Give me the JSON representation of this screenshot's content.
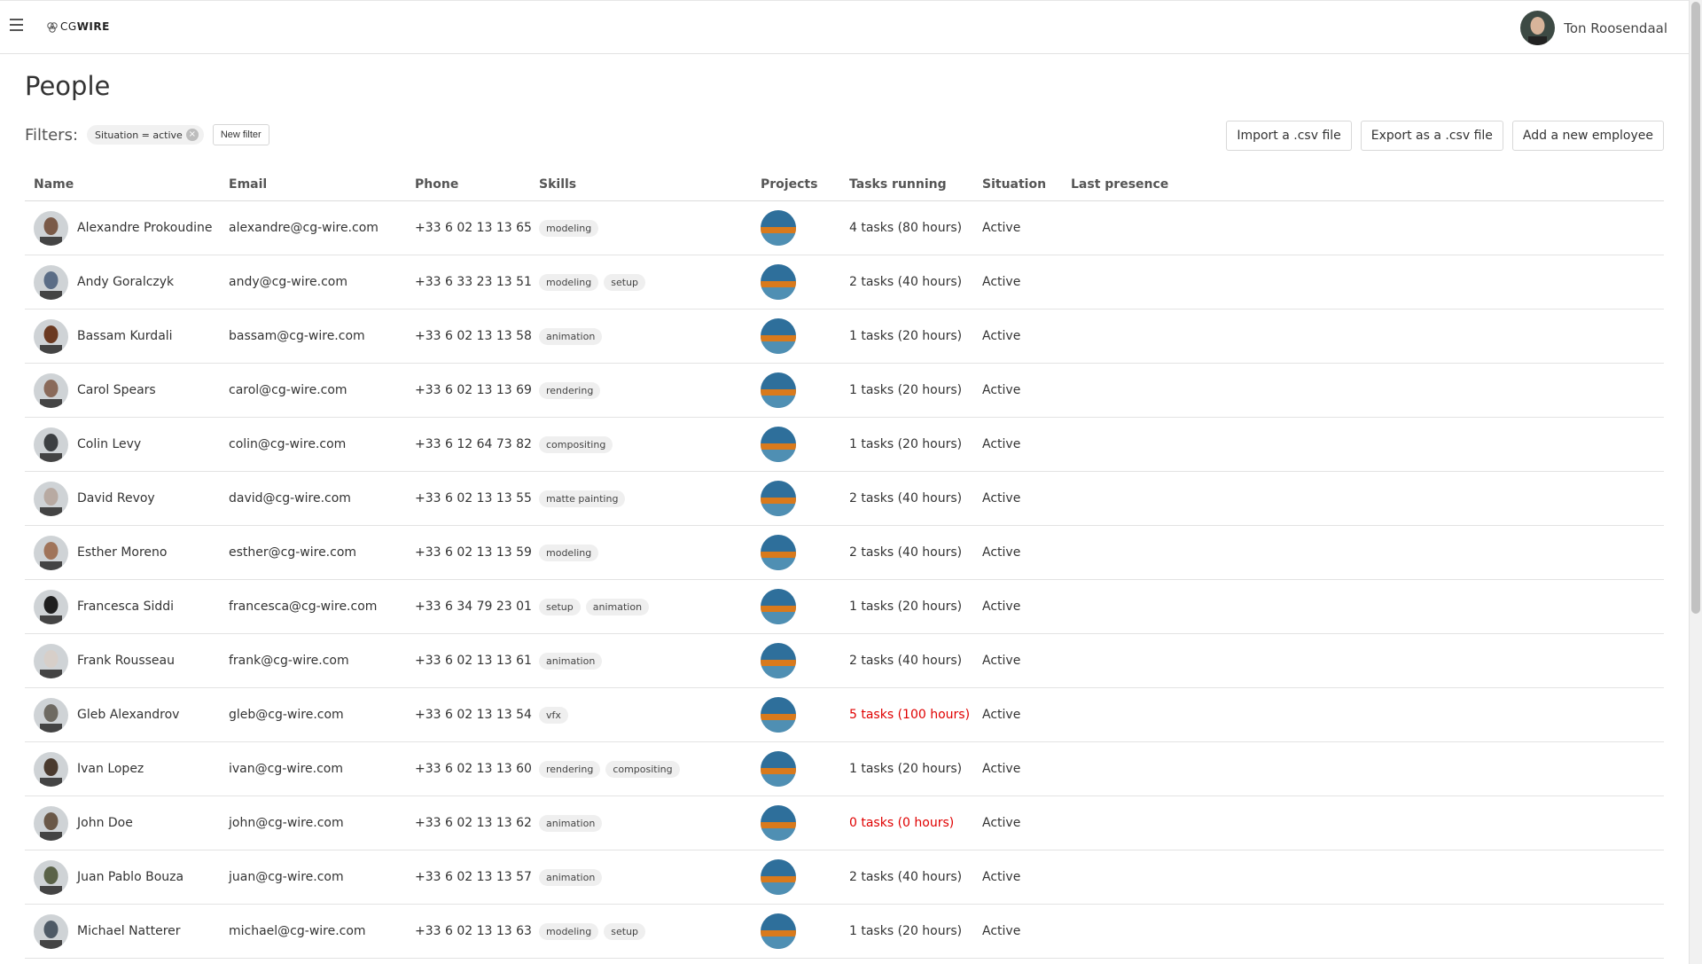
{
  "header": {
    "logo_prefix": "CG",
    "logo_suffix": "WIRE",
    "user_name": "Ton Roosendaal"
  },
  "page": {
    "title": "People",
    "filters_label": "Filters:",
    "active_filter": "Situation = active",
    "new_filter_label": "New filter",
    "import_label": "Import a .csv file",
    "export_label": "Export as a .csv file",
    "add_label": "Add a new employee"
  },
  "table": {
    "columns": {
      "name": "Name",
      "email": "Email",
      "phone": "Phone",
      "skills": "Skills",
      "projects": "Projects",
      "tasks": "Tasks running",
      "situation": "Situation",
      "last": "Last presence"
    },
    "rows": [
      {
        "name": "Alexandre Prokoudine",
        "email": "alexandre@cg-wire.com",
        "phone": "+33 6 02 13 13 65",
        "skills": [
          "modeling"
        ],
        "tasks": "4 tasks (80 hours)",
        "tasks_warn": false,
        "situation": "Active",
        "avatar_color": "#7a5a48"
      },
      {
        "name": "Andy Goralczyk",
        "email": "andy@cg-wire.com",
        "phone": "+33 6 33 23 13 51",
        "skills": [
          "modeling",
          "setup"
        ],
        "tasks": "2 tasks (40 hours)",
        "tasks_warn": false,
        "situation": "Active",
        "avatar_color": "#5b6d86"
      },
      {
        "name": "Bassam Kurdali",
        "email": "bassam@cg-wire.com",
        "phone": "+33 6 02 13 13 58",
        "skills": [
          "animation"
        ],
        "tasks": "1 tasks (20 hours)",
        "tasks_warn": false,
        "situation": "Active",
        "avatar_color": "#6b3a22"
      },
      {
        "name": "Carol Spears",
        "email": "carol@cg-wire.com",
        "phone": "+33 6 02 13 13 69",
        "skills": [
          "rendering"
        ],
        "tasks": "1 tasks (20 hours)",
        "tasks_warn": false,
        "situation": "Active",
        "avatar_color": "#8a6a5a"
      },
      {
        "name": "Colin Levy",
        "email": "colin@cg-wire.com",
        "phone": "+33 6 12 64 73 82",
        "skills": [
          "compositing"
        ],
        "tasks": "1 tasks (20 hours)",
        "tasks_warn": false,
        "situation": "Active",
        "avatar_color": "#3c3f42"
      },
      {
        "name": "David Revoy",
        "email": "david@cg-wire.com",
        "phone": "+33 6 02 13 13 55",
        "skills": [
          "matte painting"
        ],
        "tasks": "2 tasks (40 hours)",
        "tasks_warn": false,
        "situation": "Active",
        "avatar_color": "#b8aaa2"
      },
      {
        "name": "Esther Moreno",
        "email": "esther@cg-wire.com",
        "phone": "+33 6 02 13 13 59",
        "skills": [
          "modeling"
        ],
        "tasks": "2 tasks (40 hours)",
        "tasks_warn": false,
        "situation": "Active",
        "avatar_color": "#a0745a"
      },
      {
        "name": "Francesca Siddi",
        "email": "francesca@cg-wire.com",
        "phone": "+33 6 34 79 23 01",
        "skills": [
          "setup",
          "animation"
        ],
        "tasks": "1 tasks (20 hours)",
        "tasks_warn": false,
        "situation": "Active",
        "avatar_color": "#1f1f1f"
      },
      {
        "name": "Frank Rousseau",
        "email": "frank@cg-wire.com",
        "phone": "+33 6 02 13 13 61",
        "skills": [
          "animation"
        ],
        "tasks": "2 tasks (40 hours)",
        "tasks_warn": false,
        "situation": "Active",
        "avatar_color": "#d7cfc9"
      },
      {
        "name": "Gleb Alexandrov",
        "email": "gleb@cg-wire.com",
        "phone": "+33 6 02 13 13 54",
        "skills": [
          "vfx"
        ],
        "tasks": "5 tasks (100 hours)",
        "tasks_warn": true,
        "situation": "Active",
        "avatar_color": "#6e6a62"
      },
      {
        "name": "Ivan Lopez",
        "email": "ivan@cg-wire.com",
        "phone": "+33 6 02 13 13 60",
        "skills": [
          "rendering",
          "compositing"
        ],
        "tasks": "1 tasks (20 hours)",
        "tasks_warn": false,
        "situation": "Active",
        "avatar_color": "#4a3a2e"
      },
      {
        "name": "John Doe",
        "email": "john@cg-wire.com",
        "phone": "+33 6 02 13 13 62",
        "skills": [
          "animation"
        ],
        "tasks": "0 tasks (0 hours)",
        "tasks_warn": true,
        "situation": "Active",
        "avatar_color": "#6a5848"
      },
      {
        "name": "Juan Pablo Bouza",
        "email": "juan@cg-wire.com",
        "phone": "+33 6 02 13 13 57",
        "skills": [
          "animation"
        ],
        "tasks": "2 tasks (40 hours)",
        "tasks_warn": false,
        "situation": "Active",
        "avatar_color": "#5a6248"
      },
      {
        "name": "Michael Natterer",
        "email": "michael@cg-wire.com",
        "phone": "+33 6 02 13 13 63",
        "skills": [
          "modeling",
          "setup"
        ],
        "tasks": "1 tasks (20 hours)",
        "tasks_warn": false,
        "situation": "Active",
        "avatar_color": "#4e5a66"
      }
    ]
  },
  "colors": {
    "warn": "#e00000",
    "project_sky": "#2e6f9b",
    "project_fire": "#d97a1c"
  }
}
